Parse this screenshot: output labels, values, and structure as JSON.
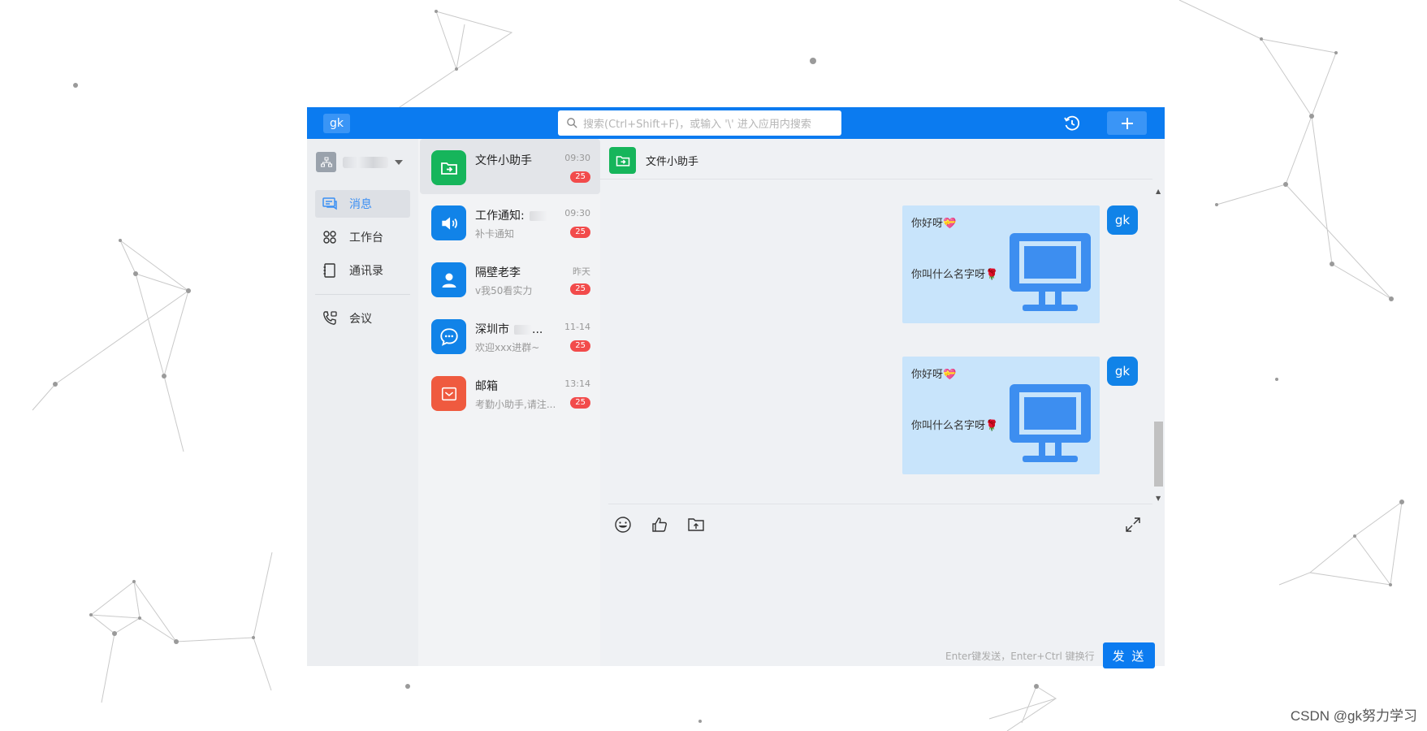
{
  "topbar": {
    "logo": "gk",
    "search_placeholder": "搜索(Ctrl+Shift+F)，或输入 '\\' 进入应用内搜索"
  },
  "nav": {
    "items": [
      {
        "label": "消息",
        "icon": "message-icon",
        "active": true
      },
      {
        "label": "工作台",
        "icon": "workbench-icon",
        "active": false
      },
      {
        "label": "通讯录",
        "icon": "contacts-icon",
        "active": false
      },
      {
        "label": "会议",
        "icon": "meeting-icon",
        "active": false
      }
    ]
  },
  "conversations": [
    {
      "title": "文件小助手",
      "subtitle": "",
      "time": "09:30",
      "badge": "25",
      "icon": "file-transfer-icon",
      "color": "#16b55b",
      "active": true
    },
    {
      "title": "工作通知:",
      "subtitle": "补卡通知",
      "time": "09:30",
      "badge": "25",
      "icon": "speaker-icon",
      "color": "#1183e8",
      "active": false
    },
    {
      "title": "隔壁老李",
      "subtitle": "v我50看实力",
      "time": "昨天",
      "badge": "25",
      "icon": "person-icon",
      "color": "#1183e8",
      "active": false
    },
    {
      "title": "深圳市",
      "subtitle": "欢迎xxx进群~",
      "time": "11-14",
      "badge": "25",
      "icon": "group-chat-icon",
      "color": "#1183e8",
      "active": false
    },
    {
      "title": "邮箱",
      "subtitle": "考勤小助手,请注...",
      "time": "13:14",
      "badge": "25",
      "icon": "mail-icon",
      "color": "#ef5a3f",
      "active": false
    }
  ],
  "chat": {
    "title": "文件小助手",
    "messages": [
      {
        "line1": "你好呀💝",
        "line2": "你叫什么名字呀🌹",
        "avatar": "gk"
      },
      {
        "line1": "你好呀💝",
        "line2": "你叫什么名字呀🌹",
        "avatar": "gk"
      }
    ],
    "hint": "Enter键发送，Enter+Ctrl 键换行",
    "send_label": "发 送"
  },
  "watermark": "CSDN @gk努力学习",
  "colors": {
    "brand": "#0b7bf0",
    "badge": "#f24b4b",
    "bubble": "#c8e4fb"
  }
}
